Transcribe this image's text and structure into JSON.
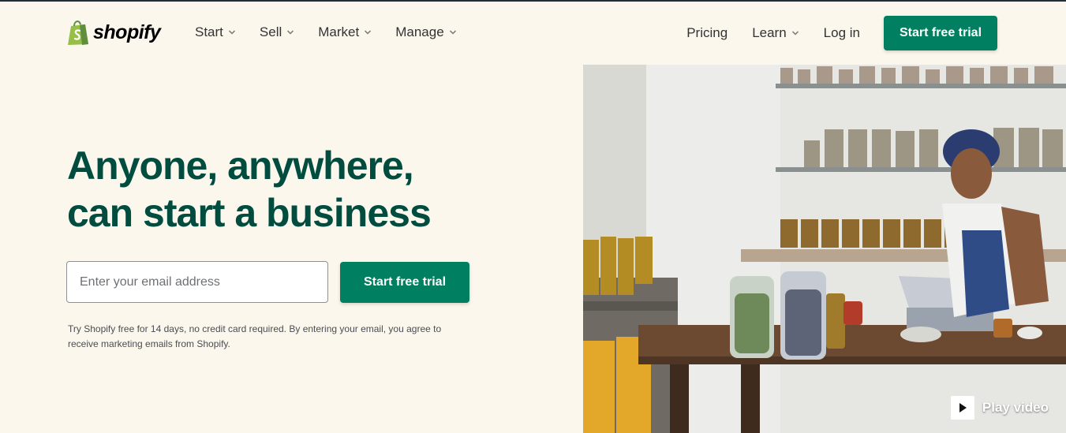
{
  "header": {
    "logo_text": "shopify",
    "nav": [
      {
        "label": "Start"
      },
      {
        "label": "Sell"
      },
      {
        "label": "Market"
      },
      {
        "label": "Manage"
      }
    ],
    "pricing_label": "Pricing",
    "learn_label": "Learn",
    "login_label": "Log in",
    "cta_label": "Start free trial"
  },
  "hero": {
    "headline_line1": "Anyone, anywhere,",
    "headline_line2": "can start a business",
    "email_placeholder": "Enter your email address",
    "cta_label": "Start free trial",
    "disclaimer": "Try Shopify free for 14 days, no credit card required. By entering your email, you agree to receive marketing emails from Shopify."
  },
  "media": {
    "play_label": "Play video"
  },
  "colors": {
    "background": "#fbf7ed",
    "brand_green": "#008060",
    "headline": "#004c3f",
    "logo_green": "#95bf47"
  }
}
